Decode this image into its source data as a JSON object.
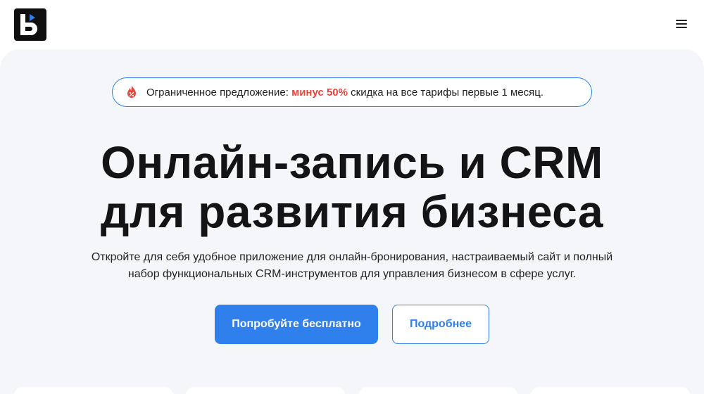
{
  "header": {
    "logo_icon": "brand-logo-icon",
    "menu_icon": "hamburger-menu-icon"
  },
  "promo": {
    "icon": "fire-percent-icon",
    "prefix": "Ограниченное предложение: ",
    "accent": "минус 50%",
    "suffix": " скидка на все тарифы первые 1 месяц.",
    "accent_color": "#e8463a",
    "border_color": "#2f80ed"
  },
  "hero": {
    "title_line1": "Онлайн-запись и CRM",
    "title_line2": "для развития бизнеса",
    "subtitle_line1": "Откройте для себя удобное приложение для онлайн-бронирования, настраиваемый сайт и полный",
    "subtitle_line2": "набор функциональных CRM-инструментов для управления бизнесом в сфере услуг."
  },
  "actions": {
    "primary_label": "Попробуйте бесплатно",
    "secondary_label": "Подробнее",
    "accent_color": "#2f80ed"
  }
}
